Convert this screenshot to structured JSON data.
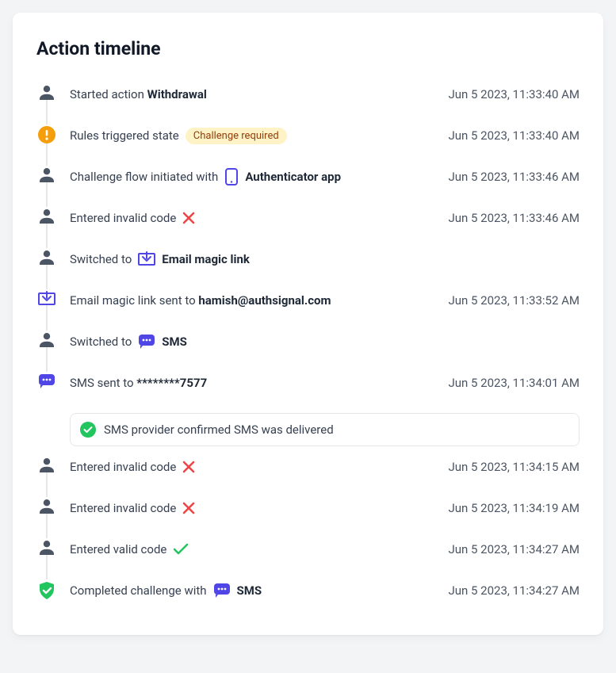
{
  "title": "Action timeline",
  "events": [
    {
      "icon": "person",
      "text": "Started action ",
      "bold": "Withdrawal",
      "time": "Jun 5 2023, 11:33:40 AM"
    },
    {
      "icon": "warning",
      "text": "Rules triggered state",
      "badge": "Challenge required",
      "time": "Jun 5 2023, 11:33:40 AM"
    },
    {
      "icon": "person",
      "text": "Challenge flow initiated with",
      "mini": "phone",
      "afterBold": "Authenticator app",
      "time": "Jun 5 2023, 11:33:46 AM"
    },
    {
      "icon": "person",
      "text": "Entered invalid code",
      "mini": "x",
      "time": "Jun 5 2023, 11:33:46 AM"
    },
    {
      "icon": "person",
      "text": "Switched to",
      "mini": "inbox",
      "afterBold": "Email magic link"
    },
    {
      "icon": "inbox",
      "text": "Email magic link sent to ",
      "bold": "hamish@authsignal.com",
      "time": "Jun 5 2023, 11:33:52 AM"
    },
    {
      "icon": "person",
      "text": "Switched to",
      "mini": "bubble",
      "afterBold": "SMS"
    },
    {
      "icon": "bubble",
      "text": "SMS sent to ",
      "bold": "********7577",
      "time": "Jun 5 2023, 11:34:01 AM",
      "sub": "SMS provider confirmed SMS was delivered"
    },
    {
      "icon": "person",
      "text": "Entered invalid code",
      "mini": "x",
      "time": "Jun 5 2023, 11:34:15 AM"
    },
    {
      "icon": "person",
      "text": "Entered invalid code",
      "mini": "x",
      "time": "Jun 5 2023, 11:34:19 AM"
    },
    {
      "icon": "person",
      "text": "Entered valid code",
      "mini": "check",
      "time": "Jun 5 2023, 11:34:27 AM"
    },
    {
      "icon": "shield",
      "text": "Completed challenge with",
      "mini": "bubble",
      "afterBold": "SMS",
      "time": "Jun 5 2023, 11:34:27 AM"
    }
  ]
}
